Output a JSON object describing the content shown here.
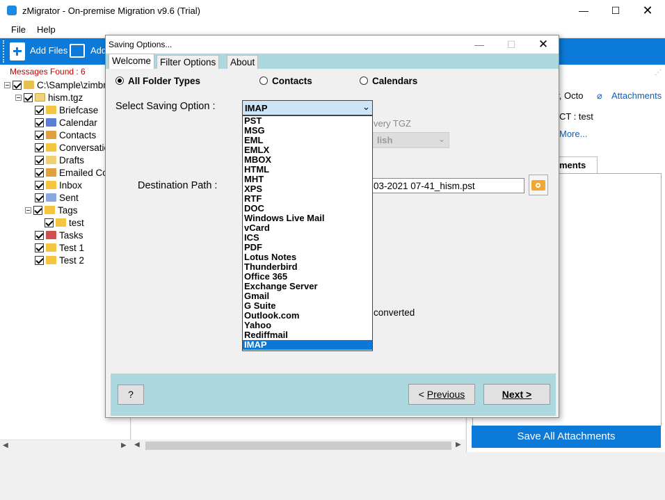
{
  "window": {
    "title": "zMigrator - On-premise Migration v9.6 (Trial)"
  },
  "menu": {
    "file": "File",
    "help": "Help"
  },
  "toolbar": {
    "add_files": "Add Files",
    "add_folder": "Add"
  },
  "left": {
    "messages_found": "Messages Found : 6",
    "root": "C:\\Sample\\zimbra",
    "archive": "hism.tgz",
    "folders": [
      "Briefcase",
      "Calendar",
      "Contacts",
      "Conversations",
      "Drafts",
      "Emailed Contacts",
      "Inbox",
      "Sent",
      "Tags",
      "test",
      "Tasks",
      "Test 1",
      "Test 2"
    ]
  },
  "right": {
    "date_fragment": "ay, Octo",
    "attachments_link": "Attachments",
    "ct_fragment": "CT : test",
    "more_link": "More...",
    "tab_fragment": "ments",
    "save_all": "Save All  Attachments"
  },
  "dialog": {
    "title": "Saving Options...",
    "tabs": [
      "Welcome",
      "Filter Options",
      "About"
    ],
    "radios": {
      "all": "All Folder Types",
      "contacts": "Contacts",
      "calendars": "Calendars"
    },
    "select_label": "Select Saving Option :",
    "selected_value": "IMAP",
    "options": [
      "PST",
      "MSG",
      "EML",
      "EMLX",
      "MBOX",
      "HTML",
      "MHT",
      "XPS",
      "RTF",
      "DOC",
      "Windows Live Mail",
      "vCard",
      "ICS",
      "PDF",
      "Lotus Notes",
      "Thunderbird",
      "Office 365",
      "Exchange Server",
      "Gmail",
      "G Suite",
      "Outlook.com",
      "Yahoo",
      "Rediffmail",
      "IMAP"
    ],
    "recovery_fragment": "very TGZ",
    "lang_fragment": "lish",
    "dest_label": "Destination Path :",
    "dest_value": "03-2021 07-41_hism.pst",
    "not_converted_fragment": "ot converted",
    "help_btn": "?",
    "prev_btn": "Previous",
    "next_btn": "Next >"
  },
  "colors": {
    "accent": "#0b7ad8",
    "dialog_band": "#add8e0",
    "selected_option": "#0b78d7"
  }
}
